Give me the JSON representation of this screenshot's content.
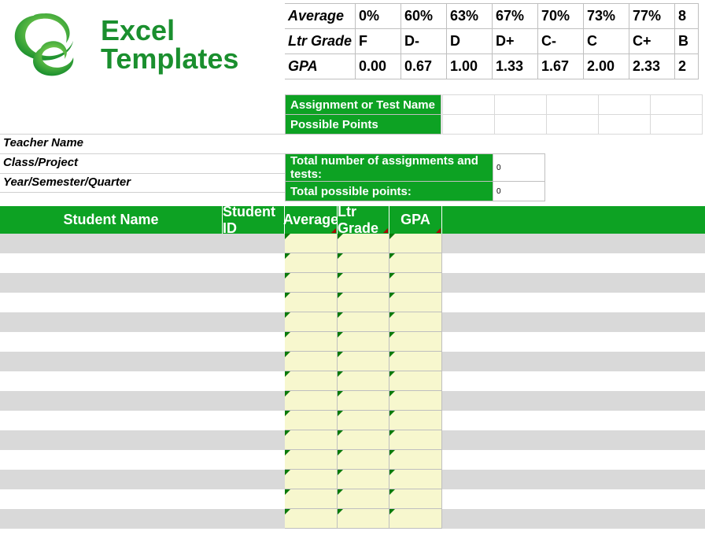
{
  "logo": {
    "line1": "Excel",
    "line2": "Templates"
  },
  "scale": {
    "rows": [
      {
        "label": "Average",
        "values": [
          "0%",
          "60%",
          "63%",
          "67%",
          "70%",
          "73%",
          "77%",
          "8"
        ]
      },
      {
        "label": "Ltr Grade",
        "values": [
          "F",
          "D-",
          "D",
          "D+",
          "C-",
          "C",
          "C+",
          "B"
        ]
      },
      {
        "label": "GPA",
        "values": [
          "0.00",
          "0.67",
          "1.00",
          "1.33",
          "1.67",
          "2.00",
          "2.33",
          "2"
        ]
      }
    ]
  },
  "assign": {
    "row1": "Assignment or Test Name",
    "row2": "Possible Points"
  },
  "left_labels": [
    "Teacher Name",
    "Class/Project",
    "Year/Semester/Quarter"
  ],
  "totals": {
    "row1": {
      "label": "Total number of assignments and tests:",
      "value": "0"
    },
    "row2": {
      "label": "Total possible points:",
      "value": "0"
    }
  },
  "headers": {
    "name": "Student Name",
    "id": "Student ID",
    "avg": "Average",
    "ltr": "Ltr Grade",
    "gpa": "GPA"
  },
  "data_row_count": 15
}
